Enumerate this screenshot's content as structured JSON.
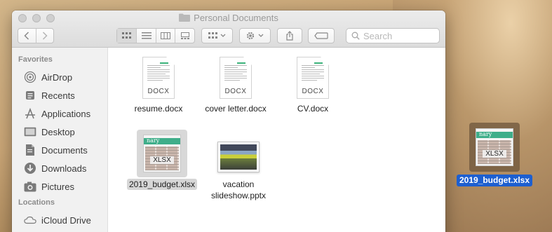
{
  "window": {
    "title": "Personal Documents"
  },
  "toolbar": {
    "back_icon": "chevron-left-icon",
    "forward_icon": "chevron-right-icon",
    "views": [
      "icon-view-icon",
      "list-view-icon",
      "column-view-icon",
      "gallery-view-icon"
    ],
    "active_view": "icon-view-icon",
    "group_icon": "group-icon",
    "action_icon": "gear-icon",
    "share_icon": "share-icon",
    "tag_icon": "tag-icon",
    "search_placeholder": "Search"
  },
  "sidebar": {
    "favorites_heading": "Favorites",
    "favorites": [
      {
        "label": "AirDrop",
        "icon": "airdrop-icon"
      },
      {
        "label": "Recents",
        "icon": "recents-icon"
      },
      {
        "label": "Applications",
        "icon": "applications-icon"
      },
      {
        "label": "Desktop",
        "icon": "desktop-icon"
      },
      {
        "label": "Documents",
        "icon": "documents-icon"
      },
      {
        "label": "Downloads",
        "icon": "downloads-icon"
      },
      {
        "label": "Pictures",
        "icon": "pictures-icon"
      }
    ],
    "locations_heading": "Locations",
    "locations": [
      {
        "label": "iCloud Drive",
        "icon": "icloud-icon"
      }
    ]
  },
  "files": [
    {
      "name": "resume.docx",
      "type": "DOCX",
      "selected": false
    },
    {
      "name": "cover letter.docx",
      "type": "DOCX",
      "selected": false
    },
    {
      "name": "CV.docx",
      "type": "DOCX",
      "selected": false
    },
    {
      "name": "2019_budget.xlsx",
      "type": "XLSX",
      "selected": true
    },
    {
      "name": "vacation slideshow.pptx",
      "type": "PPTX",
      "selected": false
    }
  ],
  "drag_item": {
    "name": "2019_budget.xlsx",
    "type": "XLSX"
  },
  "colors": {
    "selection_blue": "#1d5fd0",
    "spreadsheet_green": "#3fae8a",
    "doc_accent_green": "#3bb37a"
  }
}
